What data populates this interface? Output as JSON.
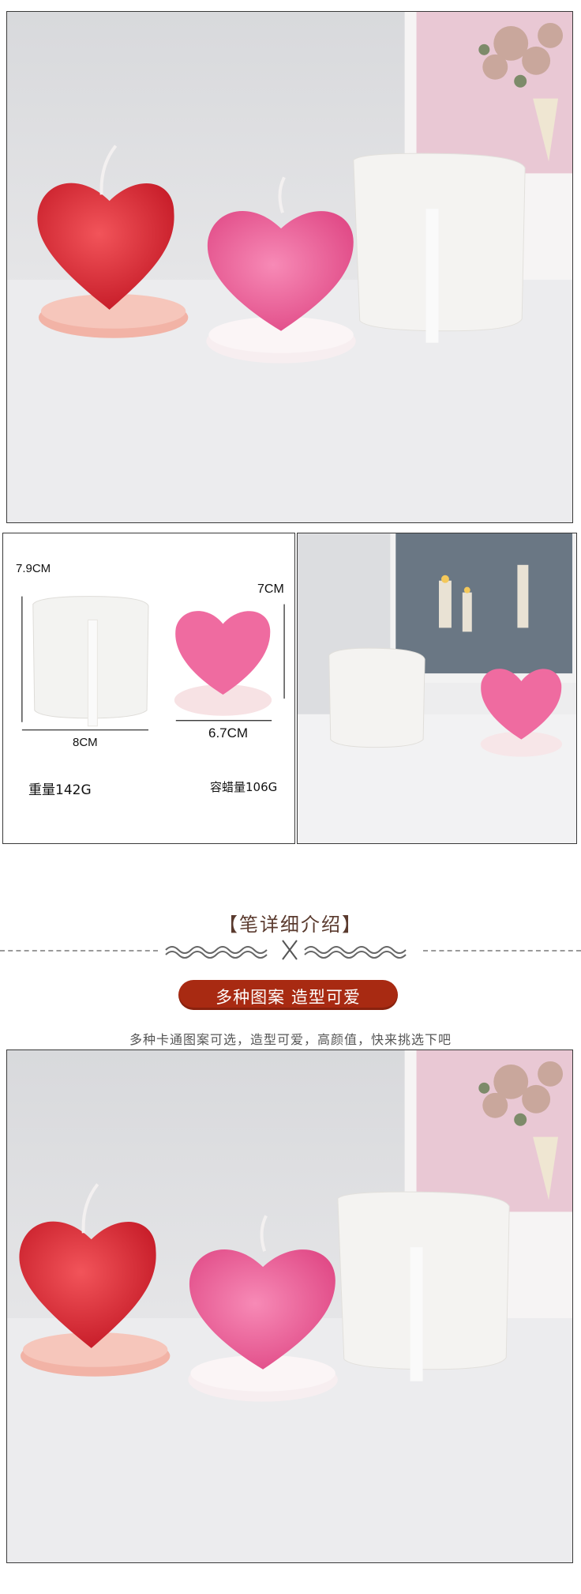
{
  "size_diagram": {
    "mold": {
      "height": "7.9CM",
      "width": "8CM",
      "weight": "重量142G"
    },
    "candle": {
      "height": "7CM",
      "width": "6.7CM",
      "wax": "容蜡量106G"
    }
  },
  "section": {
    "title": "【笔详细介绍】",
    "pill": "多种图案  造型可爱",
    "subtitle": "多种卡通图案可选，造型可爱，高颜值，快来挑选下吧"
  },
  "colors": {
    "accent": "#a82a12",
    "heading": "#5a3a2e",
    "red_candle": "#e0303a",
    "pink_candle": "#f06a9e"
  }
}
